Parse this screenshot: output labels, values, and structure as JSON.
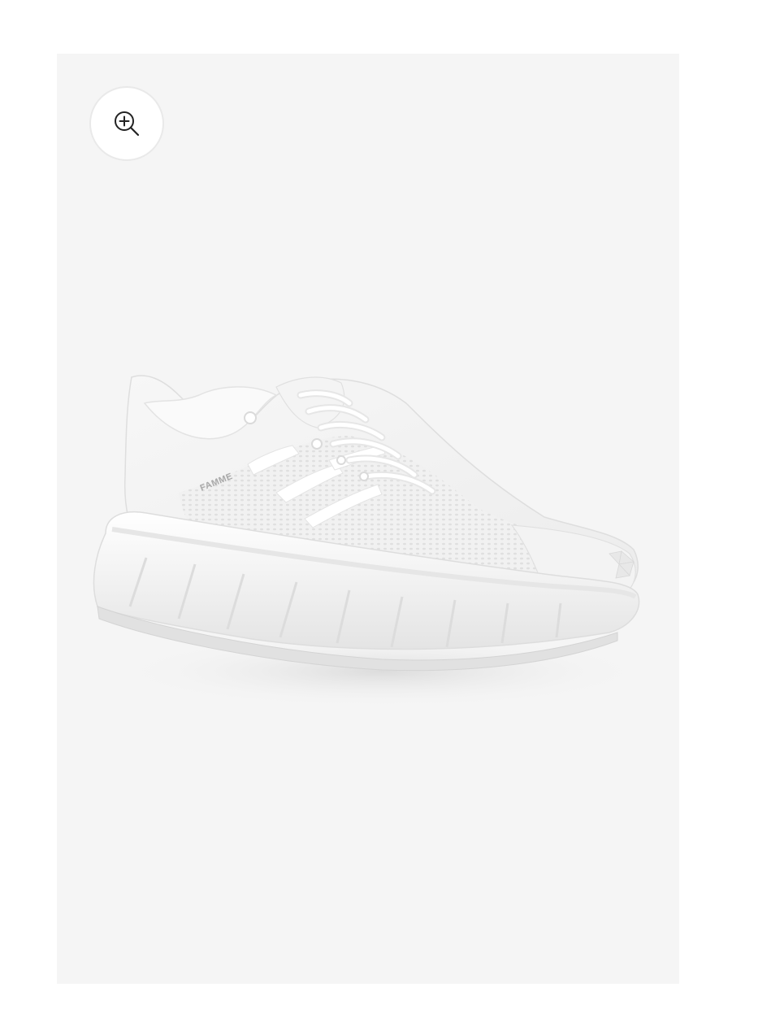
{
  "gallery": {
    "background": "#f5f5f5",
    "zoom_button": {
      "icon": "zoom-in-icon",
      "label": "Zoom image"
    },
    "image": {
      "subject": "white-running-sneaker",
      "brand_print": "FAMME"
    }
  }
}
